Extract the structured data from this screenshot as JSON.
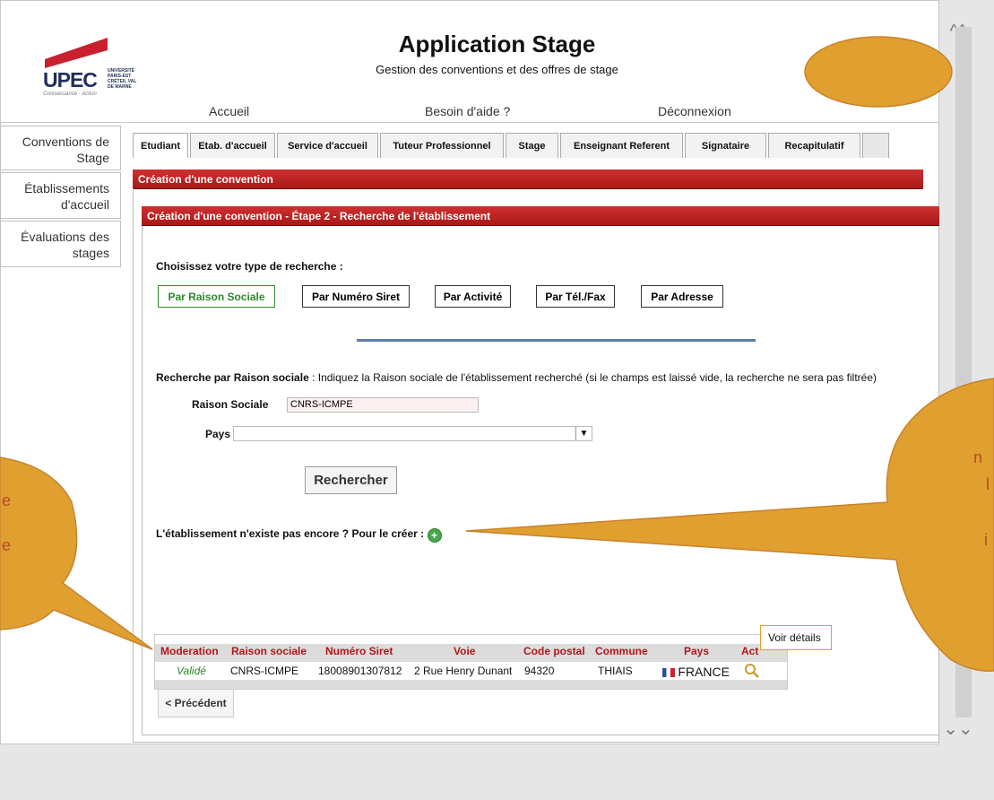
{
  "app": {
    "title": "Application Stage",
    "subtitle": "Gestion des conventions et des offres de stage",
    "logo_text": "UPEC",
    "logo_sub": "UNIVERSITÉ PARIS-EST CRÉTEIL VAL DE MARNE",
    "logo_tagline": "Connaissance · Action"
  },
  "topnav": [
    "Accueil",
    "Besoin d'aide ?",
    "Déconnexion"
  ],
  "sidebar": [
    {
      "line1": "Conventions de",
      "line2": "Stage"
    },
    {
      "line1": "Établissements",
      "line2": "d'accueil"
    },
    {
      "line1": "Évaluations des",
      "line2": "stages"
    }
  ],
  "tabs": [
    "Etudiant",
    "Etab. d'accueil",
    "Service d'accueil",
    "Tuteur Professionnel",
    "Stage",
    "Enseignant Referent",
    "Signataire",
    "Recapitulatif"
  ],
  "header1": "Création d'une convention",
  "header2": "Création d'une convention - Étape 2 - Recherche de l'établissement",
  "search_type_label": "Choisissez votre type de recherche :",
  "search_types": [
    "Par Raison Sociale",
    "Par Numéro Siret",
    "Par Activité",
    "Par Tél./Fax",
    "Par Adresse"
  ],
  "desc_bold": "Recherche par Raison sociale",
  "desc_text": " : Indiquez la Raison sociale de l'établissement recherché (si le champs est laissé vide, la recherche ne sera pas filtrée)",
  "form": {
    "raison_label": "Raison Sociale",
    "raison_value": "CNRS-ICMPE",
    "pays_label": "Pays",
    "pays_value": "",
    "submit": "Rechercher"
  },
  "create_text": "L'établissement n'existe pas encore ? Pour le créer :",
  "table": {
    "headers": [
      "Moderation",
      "Raison sociale",
      "Numéro Siret",
      "Voie",
      "Code postal",
      "Commune",
      "Pays",
      "Act"
    ],
    "row": [
      "Validé",
      "CNRS-ICMPE",
      "18008901307812",
      "2 Rue Henry Dunant",
      "94320",
      "THIAIS",
      "FRANCE"
    ]
  },
  "tooltip": "Voir détails",
  "prev_button": "< Précédent",
  "bubble_left_letters": [
    "e",
    "e"
  ],
  "bubble_right_letters": [
    "n",
    "l",
    "i"
  ],
  "colors": {
    "header_red": "#c02424",
    "bubble": "#e0a030",
    "valid_green": "#2b8a2b",
    "link_blue": "#5b7fae"
  }
}
